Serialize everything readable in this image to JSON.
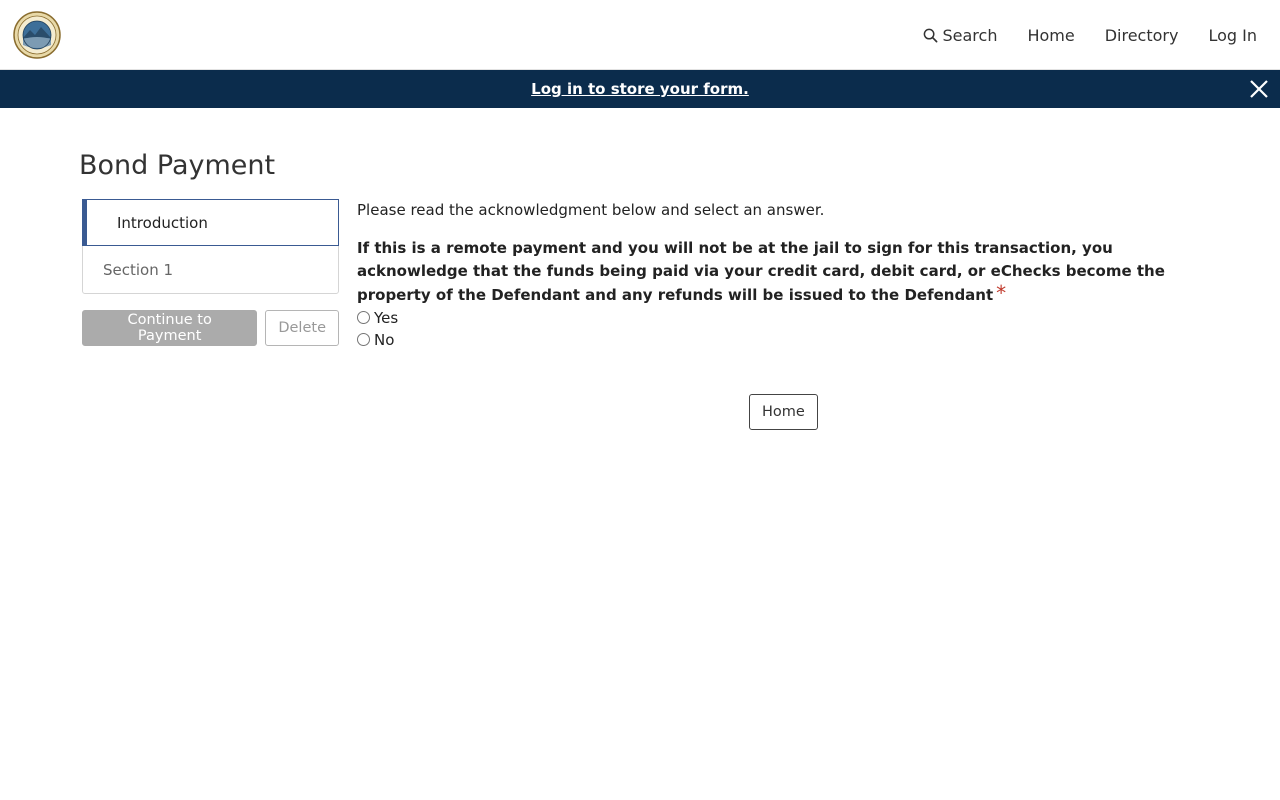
{
  "header": {
    "logo_alt": "Las Animas County Colorado seal",
    "nav": {
      "search": "Search",
      "home": "Home",
      "directory": "Directory",
      "login": "Log In"
    }
  },
  "banner": {
    "message": "Log in to store your form.",
    "background": "#0b2c4c"
  },
  "page": {
    "title": "Bond Payment"
  },
  "sidebar": {
    "items": [
      {
        "label": "Introduction",
        "active": true
      },
      {
        "label": "Section 1",
        "active": false
      }
    ],
    "continue_label": "Continue to Payment",
    "delete_label": "Delete"
  },
  "form": {
    "instruction": "Please read the acknowledgment below and select an answer.",
    "question": "If this is a remote payment and you will not be at the jail to sign for this transaction, you acknowledge that the funds being paid via your credit card, debit card, or eChecks become the property of the Defendant and any refunds will be issued to the Defendant",
    "required_marker": "*",
    "options": [
      {
        "label": "Yes",
        "checked": false
      },
      {
        "label": "No",
        "checked": false
      }
    ]
  },
  "footer_button": {
    "home_label": "Home"
  }
}
